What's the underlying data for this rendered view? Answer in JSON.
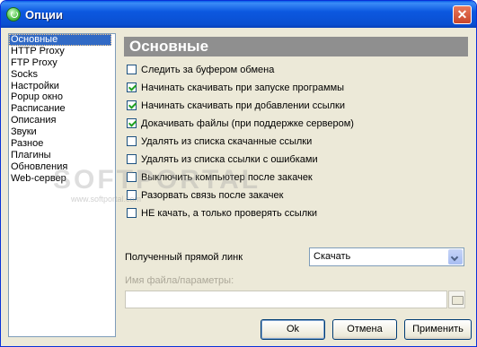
{
  "window": {
    "title": "Опции",
    "close_symbol": "✕"
  },
  "nav": {
    "items": [
      {
        "label": "Основные",
        "selected": true
      },
      {
        "label": "HTTP Proxy"
      },
      {
        "label": "FTP Proxy"
      },
      {
        "label": "Socks"
      },
      {
        "label": "Настройки"
      },
      {
        "label": "Popup окно"
      },
      {
        "label": "Расписание"
      },
      {
        "label": "Описания"
      },
      {
        "label": "Звуки"
      },
      {
        "label": "Разное"
      },
      {
        "label": "Плагины"
      },
      {
        "label": "Обновления"
      },
      {
        "label": "Web-сервер"
      }
    ]
  },
  "panel": {
    "header": "Основные",
    "options": [
      {
        "label": "Следить за буфером обмена",
        "checked": false
      },
      {
        "label": "Начинать скачивать при запуске программы",
        "checked": true
      },
      {
        "label": "Начинать скачивать при добавлении ссылки",
        "checked": true
      },
      {
        "label": "Докачивать файлы (при поддержке сервером)",
        "checked": true
      },
      {
        "label": "Удалять из списка скачанные ссылки",
        "checked": false
      },
      {
        "label": "Удалять из списка ссылки с ошибками",
        "checked": false
      },
      {
        "label": "Выключить компьютер после закачек",
        "checked": false
      },
      {
        "label": "Разорвать связь после закачек",
        "checked": false
      },
      {
        "label": "НЕ качать, а только проверять ссылки",
        "checked": false
      }
    ],
    "direct_link_label": "Полученный прямой линк",
    "direct_link_value": "Скачать",
    "file_params_label": "Имя файла/параметры:",
    "file_params_value": ""
  },
  "buttons": {
    "ok": "Ok",
    "cancel": "Отмена",
    "apply": "Применить"
  },
  "watermark": {
    "text": "SOFTPORTAL",
    "url": "www.softportal.com"
  },
  "colors": {
    "selection": "#316ac5",
    "header_bg": "#8f8f8f",
    "titlebar": "#0a58e0"
  }
}
